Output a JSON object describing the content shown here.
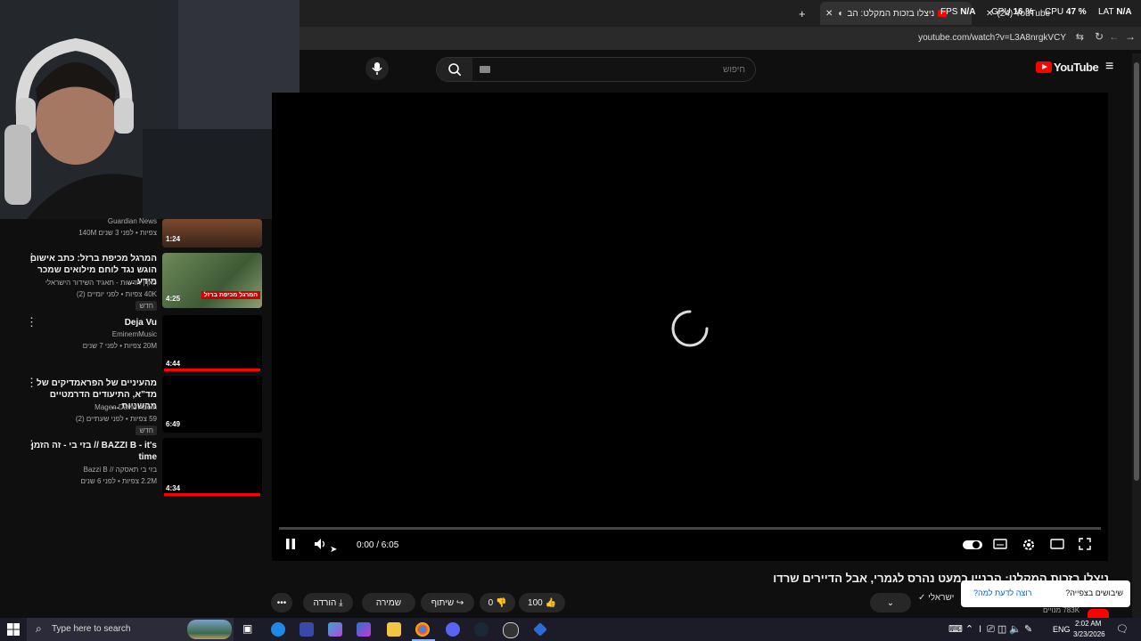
{
  "browser": {
    "tab_title": "ניצלו בזכות המקלט: הב",
    "tab2_title": "(24) YouTube",
    "new_tab": "+",
    "url": "youtube.com/watch?v=L3A8nrgkVCY",
    "close_glyph": "✕"
  },
  "overlay": {
    "fps_label": "FPS",
    "fps_value": "N/A",
    "gpu_label": "GPU",
    "gpu_value": "16 %",
    "cpu_label": "CPU",
    "cpu_value": "47 %",
    "lat_label": "LAT",
    "lat_value": "N/A"
  },
  "youtube": {
    "logo_text": "YouTube",
    "search_placeholder": "חיפוש"
  },
  "sidebar": {
    "items": [
      {
        "title": "",
        "channel": "Guardian News",
        "stats": "140M צפיות • לפני 3 שנים",
        "duration": "1:24",
        "badge": ""
      },
      {
        "title": "המרגל מכיפת ברזל: כתב אישום הוגש נגד לוחם מילואים שמכר מידע ...",
        "channel": "כאן | חדשות - תאגיד השידור הישראלי",
        "stats": "40K צפיות • לפני יומיים (2)",
        "duration": "4:25",
        "badge": "חדש",
        "thumb_caption": "המרגל מכיפת ברזל"
      },
      {
        "title": "Deja Vu",
        "channel": "EminemMusic",
        "stats": "20M צפיות • לפני 7 שנים",
        "duration": "4:44",
        "badge": ""
      },
      {
        "title": "מהעיניים של הפראמדיקים של מד\"א, התיעודים הדרמטיים מהשניות ...",
        "channel": "Magen David Adom",
        "stats": "59 צפיות • לפני שעתיים (2)",
        "duration": "6:49",
        "badge": "חדש"
      },
      {
        "title": "BAZZI B - it's // בזי בי - זה הזמן time",
        "channel": "בזי בי תאסקה // Bazzi B",
        "stats": "2.2M צפיות • לפני 6 שנים",
        "duration": "4:34",
        "badge": ""
      }
    ]
  },
  "player": {
    "time": "0:00 / 6:05"
  },
  "video": {
    "title": "ניצלו בזכות המקלט: הבניין כמעט נהרס לגמרי, אבל הדיירים שרדו",
    "channel_partial": "ישראלי",
    "subscribers": "783K מנויים",
    "likes": "100",
    "dislikes": "0",
    "share": "שיתוף",
    "save": "שמירה",
    "download": "הורדה",
    "more": "•••"
  },
  "survey": {
    "question": "שיבושים בצפייה?",
    "link": "רוצה לדעת למה?"
  },
  "taskbar": {
    "search_placeholder": "Type here to search",
    "lang": "ENG",
    "time": "2:02 AM",
    "date": "3/23/2026"
  },
  "colors": {
    "accent_red": "#ff0000",
    "bg": "#0f0f0f"
  }
}
